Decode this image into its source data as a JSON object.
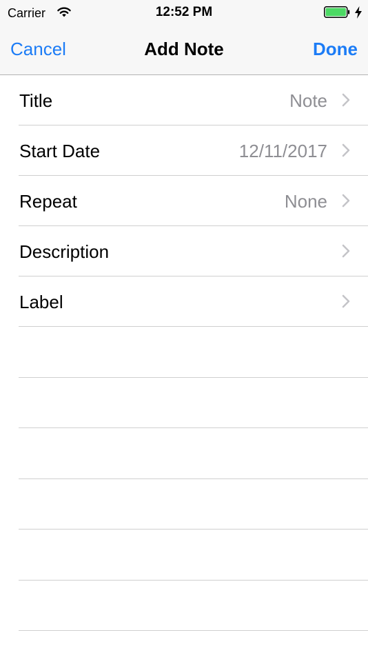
{
  "status_bar": {
    "carrier": "Carrier",
    "time": "12:52 PM",
    "wifi_icon": "wifi-icon",
    "battery_icon": "battery-icon",
    "charging_icon": "charging-bolt-icon",
    "battery_color": "#4cd964"
  },
  "nav": {
    "cancel_label": "Cancel",
    "title": "Add Note",
    "done_label": "Done",
    "accent_color": "#1c7cf6"
  },
  "rows": [
    {
      "label": "Title",
      "value": "Note"
    },
    {
      "label": "Start Date",
      "value": "12/11/2017"
    },
    {
      "label": "Repeat",
      "value": "None"
    },
    {
      "label": "Description",
      "value": ""
    },
    {
      "label": "Label",
      "value": ""
    }
  ],
  "row_icon": "chevron-right-icon"
}
